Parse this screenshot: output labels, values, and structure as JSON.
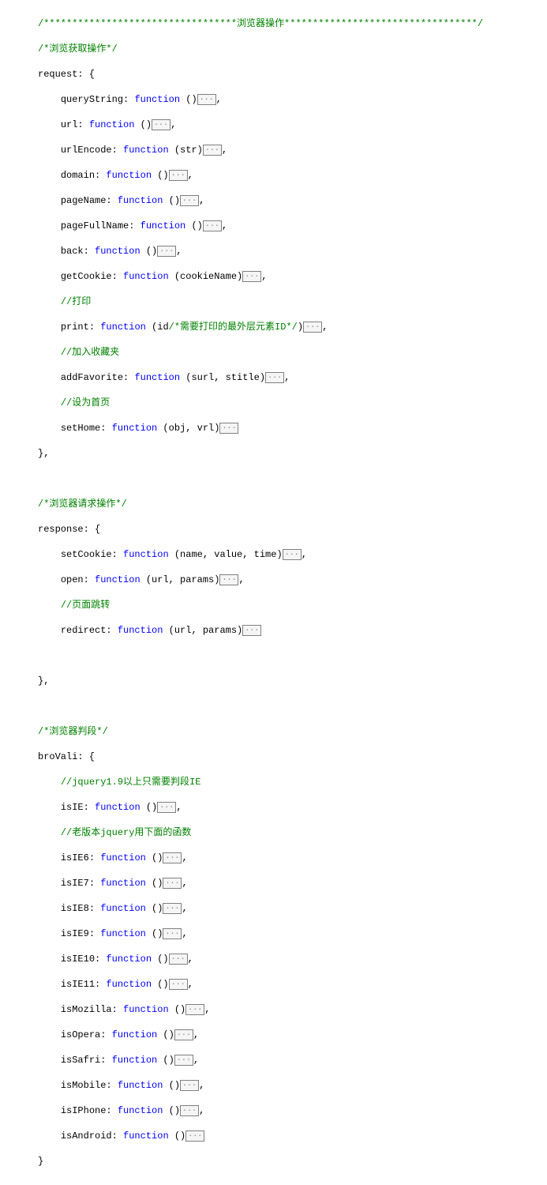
{
  "tokens": {
    "fn": "function",
    "fold": "..."
  },
  "lines": {
    "l01": "/**********************************浏览器操作**********************************/",
    "l02": "/*浏览获取操作*/",
    "l03": "request: {",
    "l04a": "queryString: ",
    "l04b": " ()",
    "l05a": "url: ",
    "l05b": " ()",
    "l06a": "urlEncode: ",
    "l06b": " (str)",
    "l07a": "domain: ",
    "l07b": " ()",
    "l08a": "pageName: ",
    "l08b": " ()",
    "l09a": "pageFullName: ",
    "l09b": " ()",
    "l10a": "back: ",
    "l10b": " ()",
    "l11a": "getCookie: ",
    "l11b": " (cookieName)",
    "l12": "//打印",
    "l13a": "print: ",
    "l13b": " (id",
    "l13c": "/*需要打印的最外层元素ID*/",
    "l13d": ")",
    "l14": "//加入收藏夹",
    "l15a": "addFavorite: ",
    "l15b": " (surl, stitle)",
    "l16": "//设为首页",
    "l17a": "setHome: ",
    "l17b": " (obj, vrl)",
    "l18": "},",
    "l20": "/*浏览器请求操作*/",
    "l21": "response: {",
    "l22a": "setCookie: ",
    "l22b": " (name, value, time)",
    "l23a": "open: ",
    "l23b": " (url, params)",
    "l24": "//页面跳转",
    "l25a": "redirect: ",
    "l25b": " (url, params)",
    "l27": "},",
    "l29": "/*浏览器判段*/",
    "l30": "broVali: {",
    "l31": "//jquery1.9以上只需要判段IE",
    "l32a": "isIE: ",
    "l32b": " ()",
    "l33": "//老版本jquery用下面的函数",
    "l34a": "isIE6: ",
    "l34b": " ()",
    "l35a": "isIE7: ",
    "l35b": " ()",
    "l36a": "isIE8: ",
    "l36b": " ()",
    "l37a": "isIE9: ",
    "l37b": " ()",
    "l38a": "isIE10: ",
    "l38b": " ()",
    "l39a": "isIE11: ",
    "l39b": " ()",
    "l40a": "isMozilla: ",
    "l40b": " ()",
    "l41a": "isOpera: ",
    "l41b": " ()",
    "l42a": "isSafri: ",
    "l42b": " ()",
    "l43a": "isMobile: ",
    "l43b": " ()",
    "l44a": "isIPhone: ",
    "l44b": " ()",
    "l45a": "isAndroid: ",
    "l45b": " ()",
    "l46": "}",
    "comma": ","
  }
}
